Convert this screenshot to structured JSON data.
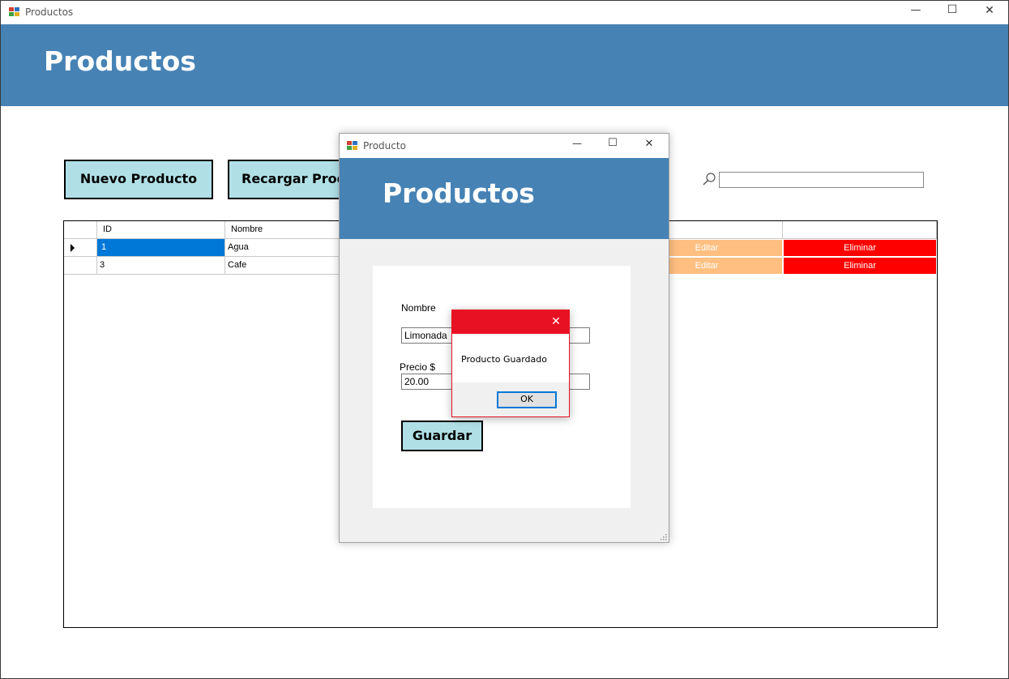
{
  "main_window": {
    "title": "Productos",
    "controls": {
      "minimize": "—",
      "maximize": "☐",
      "close": "✕"
    },
    "header_title": "Productos",
    "toolbar": {
      "new_product_label": "Nuevo Producto",
      "reload_label": "Recargar Productos"
    },
    "search": {
      "value": "",
      "icon": "search-icon"
    }
  },
  "grid": {
    "columns": [
      "ID",
      "Nombre",
      "",
      "",
      ""
    ],
    "rows": [
      {
        "id": "1",
        "nombre": "Agua",
        "edit": "Editar",
        "delete": "Eliminar",
        "selected": true
      },
      {
        "id": "3",
        "nombre": "Cafe",
        "edit": "Editar",
        "delete": "Eliminar",
        "selected": false
      }
    ]
  },
  "producto_dialog": {
    "title": "Producto",
    "header_title": "Productos",
    "nombre_label": "Nombre",
    "nombre_value": "Limonada",
    "precio_label": "Precio $",
    "precio_value": "20.00",
    "save_label": "Guardar"
  },
  "message_box": {
    "message": "Producto Guardado",
    "ok_label": "OK",
    "close": "✕"
  },
  "colors": {
    "header": "#4682b4",
    "button_bg": "#b0e0e6",
    "edit": "#ffbf80",
    "delete": "#ff0000",
    "selection": "#0078d7",
    "msgbox_accent": "#e81123"
  }
}
